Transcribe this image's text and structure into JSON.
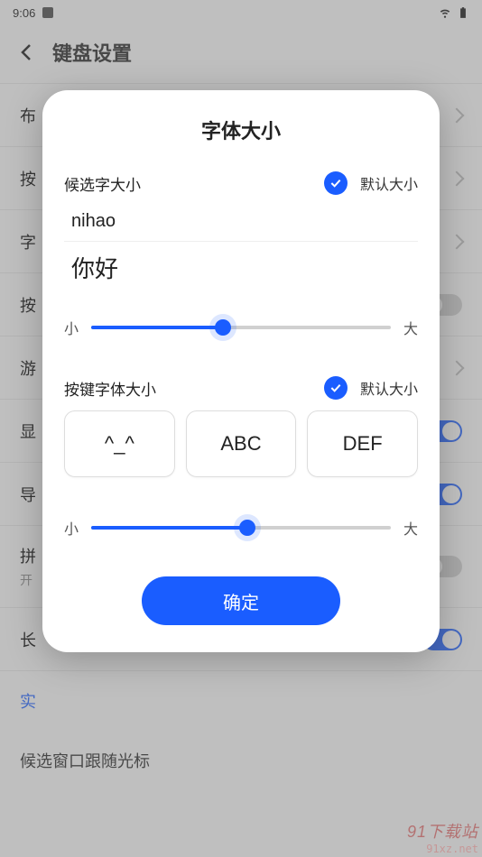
{
  "status": {
    "time": "9:06",
    "wifi": true,
    "battery": true
  },
  "header": {
    "title": "键盘设置"
  },
  "settings": [
    {
      "label": "布",
      "trailing": "chevron"
    },
    {
      "label": "按",
      "trailing": "chevron"
    },
    {
      "label": "字",
      "trailing": "chevron"
    },
    {
      "label": "按",
      "trailing": "toggle-off"
    },
    {
      "label": "游",
      "trailing": "chevron"
    },
    {
      "label": "显",
      "trailing": "toggle-on"
    },
    {
      "label": "导",
      "trailing": "toggle-on"
    },
    {
      "label": "拼",
      "sub": "开",
      "trailing": "toggle-off"
    },
    {
      "label": "长",
      "trailing": "toggle-on"
    }
  ],
  "link": {
    "label": "实"
  },
  "last": {
    "label": "候选窗口跟随光标"
  },
  "dialog": {
    "title": "字体大小",
    "section1": {
      "label": "候选字大小",
      "default_label": "默认大小",
      "preview_roman": "nihao",
      "preview_chinese": "你好",
      "slider_small": "小",
      "slider_large": "大",
      "slider_pct": 44
    },
    "section2": {
      "label": "按键字体大小",
      "default_label": "默认大小",
      "keys": [
        "^_^",
        "ABC",
        "DEF"
      ],
      "slider_small": "小",
      "slider_large": "大",
      "slider_pct": 52
    },
    "confirm": "确定"
  },
  "watermark": {
    "line1": "91下载站",
    "line2": "91xz.net"
  }
}
